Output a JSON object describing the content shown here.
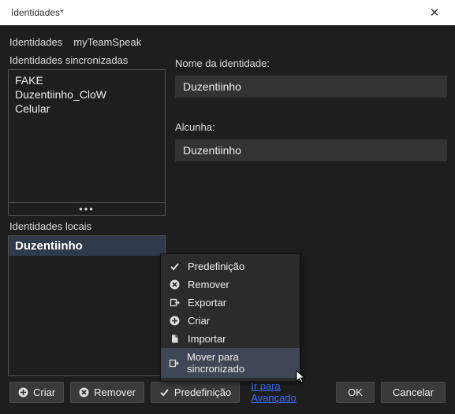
{
  "window": {
    "title": "Identidades*"
  },
  "tabs": {
    "identities": "Identidades",
    "myts": "myTeamSpeak"
  },
  "left": {
    "sync_label": "Identidades sincronizadas",
    "sync_items": [
      "FAKE",
      "Duzentiinho_CloW",
      "Celular"
    ],
    "local_label": "Identidades locais",
    "local_selected": "Duzentiinho"
  },
  "right": {
    "name_label": "Nome da identidade:",
    "name_value": "Duzentiinho",
    "nick_label": "Alcunha:",
    "nick_value": "Duzentiinho"
  },
  "context_menu": {
    "default": "Predefinição",
    "remove": "Remover",
    "export": "Exportar",
    "create": "Criar",
    "import": "Importar",
    "move_sync": "Mover para sincronizado"
  },
  "footer": {
    "create": "Criar",
    "remove": "Remover",
    "default": "Predefinição",
    "advanced": "Ir para Avançado",
    "ok": "OK",
    "cancel": "Cancelar"
  }
}
